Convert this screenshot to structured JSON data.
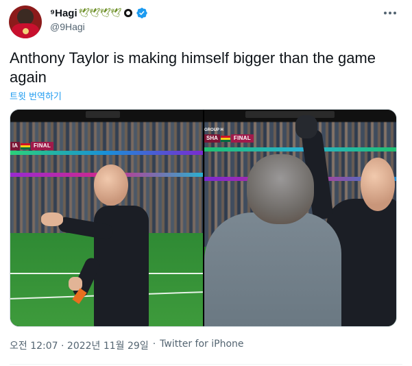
{
  "author": {
    "display_name": "⁹Hagi",
    "emoji_suffix": "🕊🕊🕊🕊",
    "handle": "@9Hagi",
    "verified": true
  },
  "tweet": {
    "text": "Anthony Taylor is making himself bigger than the game again",
    "translate_label": "트윗 번역하기",
    "timestamp": "오전 12:07 · 2022년 11월 29일",
    "separator": "·",
    "source": "Twitter for iPhone"
  },
  "media": {
    "image1": {
      "scorebug_group": "",
      "scorebug_team": "IA",
      "scorebug_status": "FINAL"
    },
    "image2": {
      "scorebug_group": "GROUP H",
      "scorebug_team": "SHA",
      "scorebug_status": "FINAL"
    }
  },
  "colors": {
    "link_blue": "#1d9bf0",
    "verified_blue": "#1d9bf0",
    "muted_text": "#536471",
    "scorebug": "#a01a4a"
  },
  "icons": {
    "more": "more-horizontal-icon",
    "verified": "verified-badge-icon",
    "affiliate": "affiliate-badge-icon"
  }
}
